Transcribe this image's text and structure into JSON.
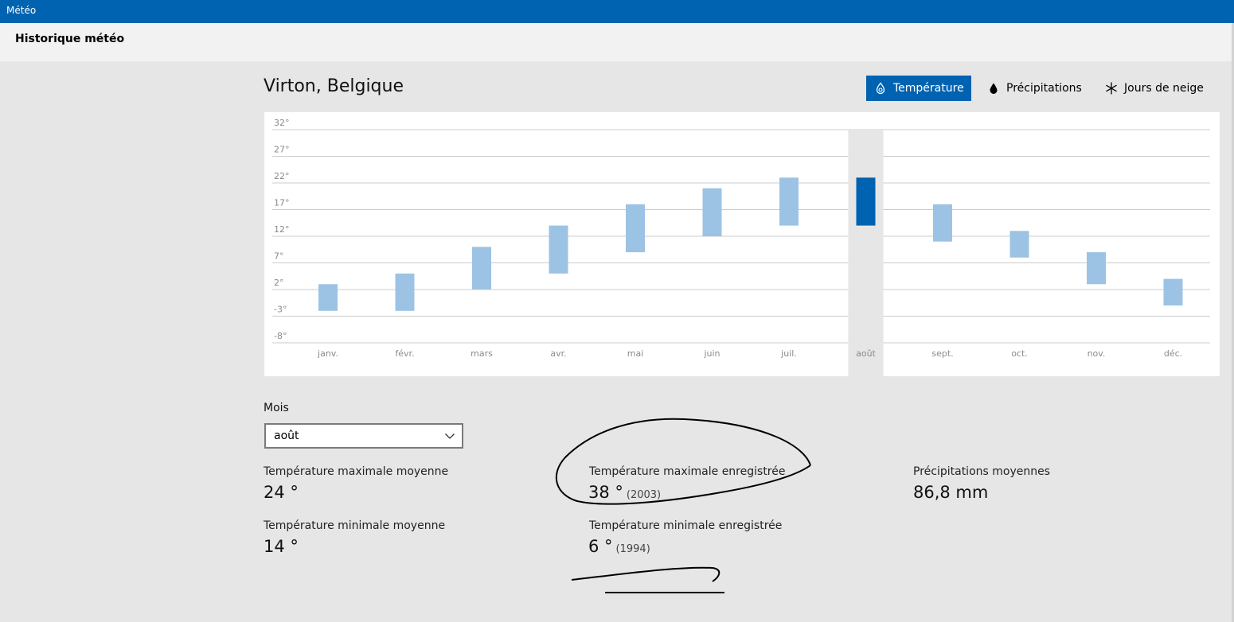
{
  "app": {
    "title": "Météo"
  },
  "page": {
    "title": "Historique météo"
  },
  "location": "Virton, Belgique",
  "tabs": [
    {
      "label": "Température",
      "icon": "thermometer-icon",
      "active": true
    },
    {
      "label": "Précipitations",
      "icon": "raindrop-icon",
      "active": false
    },
    {
      "label": "Jours de neige",
      "icon": "snowflake-icon",
      "active": false
    }
  ],
  "colors": {
    "accent": "#0063b1",
    "bar": "#9cc3e4",
    "highlight_column": "#e6e6e6",
    "grid": "#cccccc"
  },
  "chart_data": {
    "type": "bar",
    "subtype": "floating range (min–max)",
    "categories": [
      "janv.",
      "févr.",
      "mars",
      "avr.",
      "mai",
      "juin",
      "juil.",
      "août",
      "sept.",
      "oct.",
      "nov.",
      "déc."
    ],
    "series": [
      {
        "min": [
          -2,
          -2,
          2,
          5,
          9,
          12,
          14,
          14,
          11,
          8,
          3,
          -1
        ],
        "max": [
          3,
          5,
          10,
          14,
          18,
          21,
          23,
          23,
          18,
          13,
          9,
          4
        ]
      }
    ],
    "selected_index": 7,
    "y_ticks": [
      "32°",
      "27°",
      "22°",
      "17°",
      "12°",
      "7°",
      "2°",
      "-3°",
      "-8°"
    ],
    "ylim": [
      -8,
      32
    ],
    "grid": true
  },
  "month_select": {
    "label": "Mois",
    "value": "août"
  },
  "stats": {
    "avg_max": {
      "label": "Température maximale moyenne",
      "value": "24 °"
    },
    "avg_min": {
      "label": "Température minimale moyenne",
      "value": "14 °"
    },
    "rec_max": {
      "label": "Température maximale enregistrée",
      "value": "38 °",
      "year": "(2003)"
    },
    "rec_min": {
      "label": "Température minimale enregistrée",
      "value": "6 °",
      "year": "(1994)"
    },
    "precip": {
      "label": "Précipitations moyennes",
      "value": "86,8 mm"
    }
  }
}
